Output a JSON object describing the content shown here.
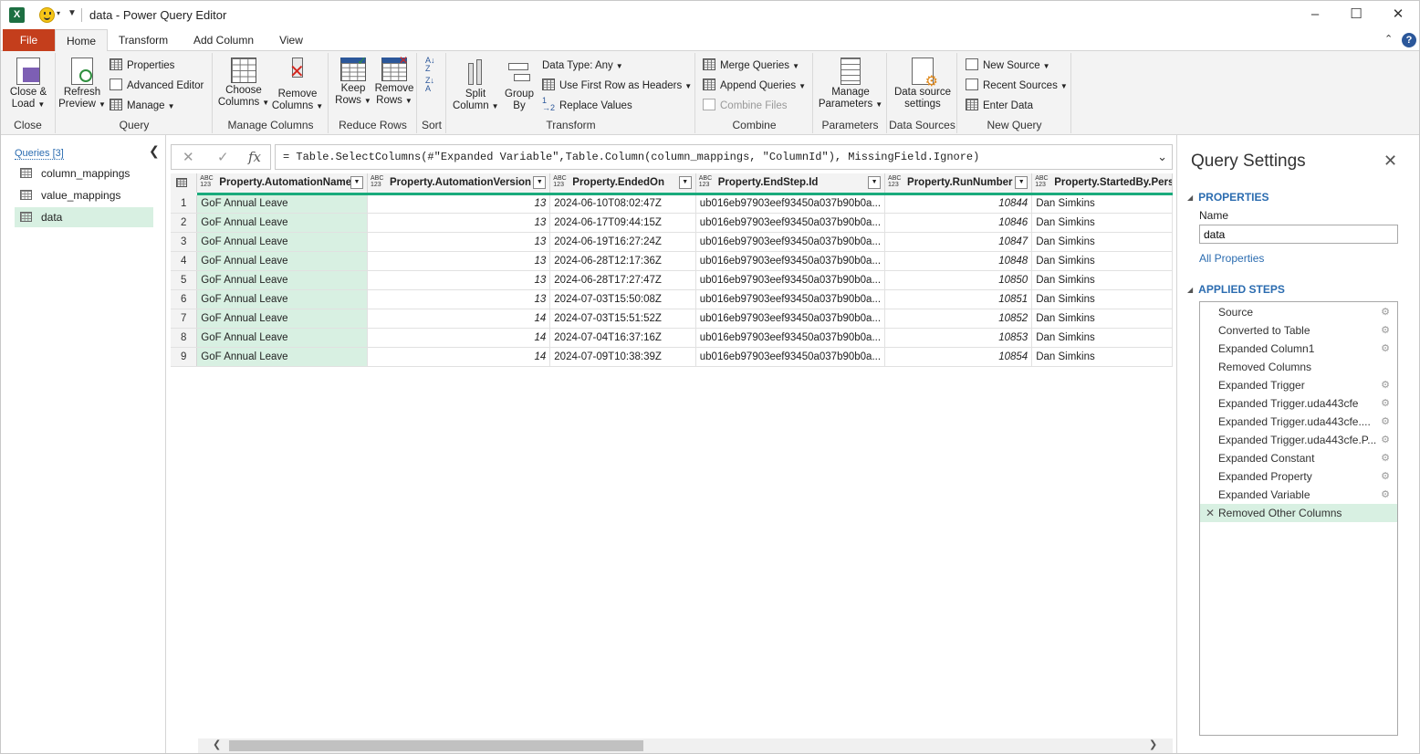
{
  "window": {
    "title": "data - Power Query Editor",
    "app_icon": "X"
  },
  "tabs": [
    {
      "label": "File"
    },
    {
      "label": "Home"
    },
    {
      "label": "Transform"
    },
    {
      "label": "Add Column"
    },
    {
      "label": "View"
    }
  ],
  "ribbon": {
    "close": {
      "close_load": "Close &",
      "close_load2": "Load",
      "group": "Close"
    },
    "query": {
      "refresh": "Refresh",
      "refresh2": "Preview",
      "properties": "Properties",
      "advanced_editor": "Advanced Editor",
      "manage": "Manage",
      "group": "Query"
    },
    "manage_columns": {
      "choose": "Choose",
      "choose2": "Columns",
      "remove": "Remove",
      "remove2": "Columns",
      "group": "Manage Columns"
    },
    "reduce_rows": {
      "keep": "Keep",
      "keep2": "Rows",
      "remove": "Remove",
      "remove2": "Rows",
      "group": "Reduce Rows"
    },
    "sort": {
      "group": "Sort"
    },
    "transform": {
      "split": "Split",
      "split2": "Column",
      "group_by": "Group",
      "group_by2": "By",
      "data_type": "Data Type: Any",
      "first_row": "Use First Row as Headers",
      "replace": "Replace Values",
      "group": "Transform"
    },
    "combine": {
      "merge": "Merge Queries",
      "append": "Append Queries",
      "combine_files": "Combine Files",
      "group": "Combine"
    },
    "parameters": {
      "manage": "Manage",
      "manage2": "Parameters",
      "group": "Parameters"
    },
    "data_sources": {
      "settings": "Data source",
      "settings2": "settings",
      "group": "Data Sources"
    },
    "new_query": {
      "new_source": "New Source",
      "recent_sources": "Recent Sources",
      "enter_data": "Enter Data",
      "group": "New Query"
    }
  },
  "queries": {
    "header": "Queries [3]",
    "items": [
      {
        "label": "column_mappings"
      },
      {
        "label": "value_mappings"
      },
      {
        "label": "data"
      }
    ]
  },
  "formula": {
    "text": "= Table.SelectColumns(#\"Expanded Variable\",Table.Column(column_mappings, \"ColumnId\"), MissingField.Ignore)"
  },
  "grid": {
    "type_label_top": "ABC",
    "type_label_bottom": "123",
    "columns": [
      "Property.AutomationName",
      "Property.AutomationVersion",
      "Property.EndedOn",
      "Property.EndStep.Id",
      "Property.RunNumber",
      "Property.StartedBy.Person"
    ],
    "rows": [
      [
        "1",
        "GoF Annual Leave",
        "13",
        "2024-06-10T08:02:47Z",
        "ub016eb97903eef93450a037b90b0a...",
        "10844",
        "Dan Simkins"
      ],
      [
        "2",
        "GoF Annual Leave",
        "13",
        "2024-06-17T09:44:15Z",
        "ub016eb97903eef93450a037b90b0a...",
        "10846",
        "Dan Simkins"
      ],
      [
        "3",
        "GoF Annual Leave",
        "13",
        "2024-06-19T16:27:24Z",
        "ub016eb97903eef93450a037b90b0a...",
        "10847",
        "Dan Simkins"
      ],
      [
        "4",
        "GoF Annual Leave",
        "13",
        "2024-06-28T12:17:36Z",
        "ub016eb97903eef93450a037b90b0a...",
        "10848",
        "Dan Simkins"
      ],
      [
        "5",
        "GoF Annual Leave",
        "13",
        "2024-06-28T17:27:47Z",
        "ub016eb97903eef93450a037b90b0a...",
        "10850",
        "Dan Simkins"
      ],
      [
        "6",
        "GoF Annual Leave",
        "13",
        "2024-07-03T15:50:08Z",
        "ub016eb97903eef93450a037b90b0a...",
        "10851",
        "Dan Simkins"
      ],
      [
        "7",
        "GoF Annual Leave",
        "14",
        "2024-07-03T15:51:52Z",
        "ub016eb97903eef93450a037b90b0a...",
        "10852",
        "Dan Simkins"
      ],
      [
        "8",
        "GoF Annual Leave",
        "14",
        "2024-07-04T16:37:16Z",
        "ub016eb97903eef93450a037b90b0a...",
        "10853",
        "Dan Simkins"
      ],
      [
        "9",
        "GoF Annual Leave",
        "14",
        "2024-07-09T10:38:39Z",
        "ub016eb97903eef93450a037b90b0a...",
        "10854",
        "Dan Simkins"
      ]
    ]
  },
  "settings": {
    "title": "Query Settings",
    "properties_header": "PROPERTIES",
    "name_label": "Name",
    "name_value": "data",
    "all_properties": "All Properties",
    "steps_header": "APPLIED STEPS",
    "steps": [
      {
        "label": "Source",
        "gear": true
      },
      {
        "label": "Converted to Table",
        "gear": true
      },
      {
        "label": "Expanded Column1",
        "gear": true
      },
      {
        "label": "Removed Columns",
        "gear": false
      },
      {
        "label": "Expanded Trigger",
        "gear": true
      },
      {
        "label": "Expanded Trigger.uda443cfe",
        "gear": true
      },
      {
        "label": "Expanded Trigger.uda443cfe....",
        "gear": true
      },
      {
        "label": "Expanded Trigger.uda443cfe.P...",
        "gear": true
      },
      {
        "label": "Expanded Constant",
        "gear": true
      },
      {
        "label": "Expanded Property",
        "gear": true
      },
      {
        "label": "Expanded Variable",
        "gear": true
      },
      {
        "label": "Removed Other Columns",
        "gear": false
      }
    ]
  },
  "colors": {
    "accent": "#1aab7c",
    "file_tab": "#c43e1c",
    "selection": "#d8f0e2",
    "link": "#2b6cb0"
  }
}
